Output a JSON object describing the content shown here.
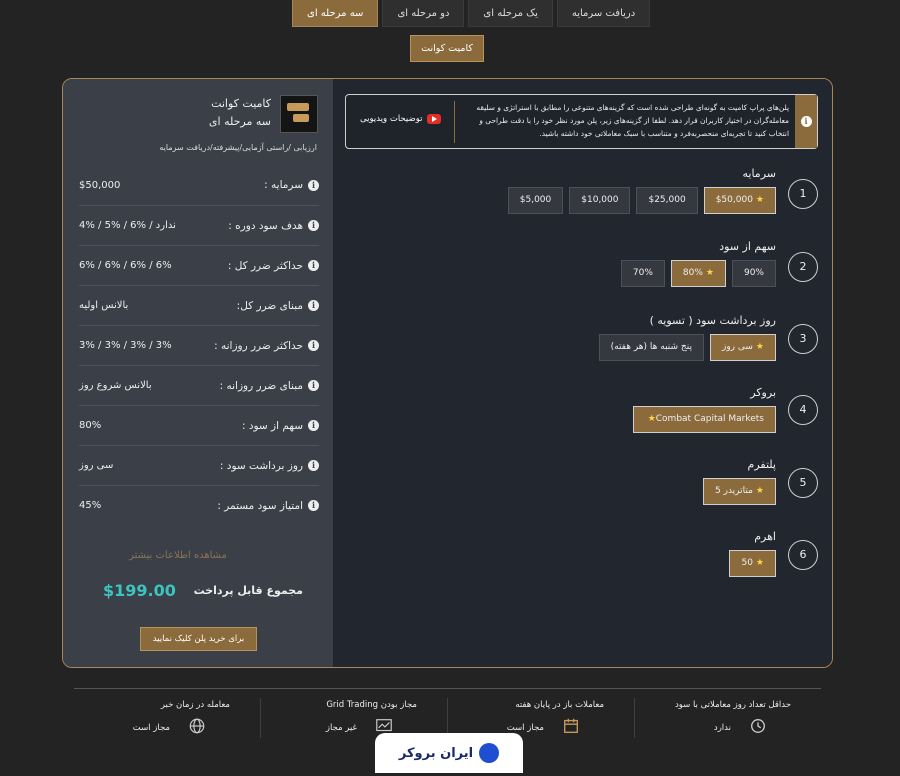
{
  "tabs": [
    {
      "label": "دریافت سرمایه",
      "active": false
    },
    {
      "label": "یک مرحله ای",
      "active": false
    },
    {
      "label": "دو مرحله ای",
      "active": false
    },
    {
      "label": "سه مرحله ای",
      "active": true
    }
  ],
  "sub_button": "کامیت کوانت",
  "product": {
    "name": "کامیت کوانت",
    "type": "سه مرحله ای",
    "steps": "ارزیابی /راستی آزمایی/پیشرفته/دریافت سرمایه"
  },
  "specs": [
    {
      "label": "سرمایه :",
      "value": "$50,000"
    },
    {
      "label": "هدف سود دوره :",
      "value": "4% / 5% / 6% / ندارد"
    },
    {
      "label": "حداکثر ضرر کل :",
      "value": "6% / 6% / 6% / 6%"
    },
    {
      "label": "مبنای ضرر کل:",
      "value": "بالانس اولیه"
    },
    {
      "label": "حداکثر ضرر روزانه :",
      "value": "3% / 3% / 3% / 3%"
    },
    {
      "label": "مبنای ضرر روزانه :",
      "value": "بالانس شروع روز"
    },
    {
      "label": "سهم از سود :",
      "value": "80%"
    },
    {
      "label": "روز برداشت سود :",
      "value": "سی روز"
    },
    {
      "label": "امتیاز سود مستمر :",
      "value": "45%"
    }
  ],
  "more_info": "مشاهده اطلاعات بیشتر",
  "total": {
    "label": "مجموع قابل پرداخت",
    "price": "$199.00"
  },
  "buy_button": "برای خرید پلن کلیک نمایید",
  "intro": {
    "text": "پلن‌های پراپ کامیت به گونه‌ای طراحی شده است که گزینه‌های متنوعی را مطابق با استراتژی و سلیقه معامله‌گران در اختیار کاربران قرار دهد. لطفا از گزینه‌های زیر، پلن مورد نظر خود را با دقت طراحی و انتخاب کنید تا تجربه‌ای منحصربه‌فرد و متناسب با سبک معاملاتی خود داشته باشید.",
    "video_label": "توضیحات ویدیویی"
  },
  "options": [
    {
      "num": "1",
      "title": "سرمایه",
      "choices": [
        {
          "label": "$50,000",
          "selected": true
        },
        {
          "label": "$25,000",
          "selected": false
        },
        {
          "label": "$10,000",
          "selected": false
        },
        {
          "label": "$5,000",
          "selected": false
        }
      ]
    },
    {
      "num": "2",
      "title": "سهم از سود",
      "choices": [
        {
          "label": "90%",
          "selected": false
        },
        {
          "label": "80%",
          "selected": true
        },
        {
          "label": "70%",
          "selected": false
        }
      ]
    },
    {
      "num": "3",
      "title": "روز برداشت سود ( تسویه )",
      "choices": [
        {
          "label": "سی روز",
          "selected": true
        },
        {
          "label": "پنج شنبه ها (هر هفته)",
          "selected": false
        }
      ]
    },
    {
      "num": "4",
      "title": "بروکر",
      "choices": [
        {
          "label": "Combat Capital Markets",
          "selected": true
        }
      ]
    },
    {
      "num": "5",
      "title": "پلتفرم",
      "choices": [
        {
          "label": "متاتریدر 5",
          "selected": true
        }
      ]
    },
    {
      "num": "6",
      "title": "اهرم",
      "choices": [
        {
          "label": "50",
          "selected": true
        }
      ]
    }
  ],
  "features": [
    {
      "title": "حداقل تعداد روز معاملاتی با سود",
      "value": "ندارد",
      "icon": "clock-calendar-icon"
    },
    {
      "title": "معاملات باز در پایان هفته",
      "value": "مجاز است",
      "icon": "calendar-edit-icon"
    },
    {
      "title": "مجاز بودن Grid Trading",
      "value": "غیر مجاز",
      "icon": "chart-line-icon"
    },
    {
      "title": "معامله در زمان خبر",
      "value": "مجاز است",
      "icon": "globe-icon"
    }
  ],
  "brand": "ایران بروکر",
  "colors": {
    "accent": "#8b6a3c",
    "price": "#3cc5c0",
    "panel": "#3a3f48",
    "background": "#232323"
  }
}
